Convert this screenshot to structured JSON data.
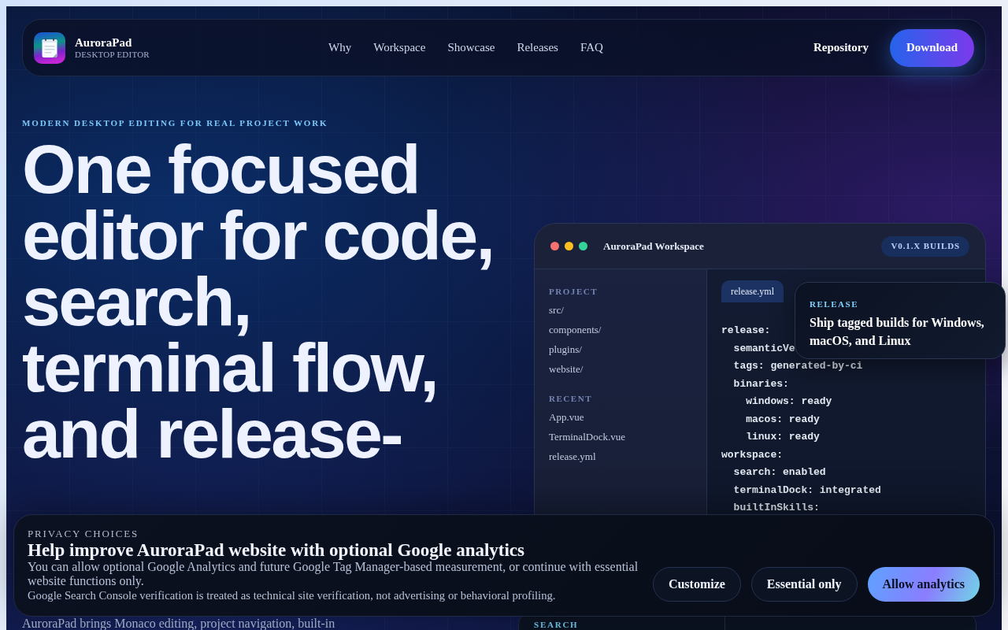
{
  "nav": {
    "brand": {
      "name": "AuroraPad",
      "tagline": "DESKTOP EDITOR"
    },
    "links": [
      {
        "label": "Why"
      },
      {
        "label": "Workspace"
      },
      {
        "label": "Showcase"
      },
      {
        "label": "Releases"
      },
      {
        "label": "FAQ"
      }
    ],
    "repository": "Repository",
    "download": "Download"
  },
  "hero": {
    "eyebrow": "MODERN DESKTOP EDITING FOR REAL PROJECT WORK",
    "headline": "One focused editor for code, search, terminal flow, and release-",
    "intro": "AuroraPad brings Monaco editing, project navigation, built-in"
  },
  "workspace": {
    "title": "AuroraPad Workspace",
    "badge": "V0.1.X BUILDS",
    "sidebar": [
      {
        "heading": "PROJECT",
        "items": [
          "src/",
          "components/",
          "plugins/",
          "website/"
        ]
      },
      {
        "heading": "RECENT",
        "items": [
          "App.vue",
          "TerminalDock.vue",
          "release.yml"
        ]
      }
    ],
    "tabs": [
      {
        "label": "release.yml",
        "selected": true
      }
    ],
    "code": [
      {
        "text": "release:",
        "children": [
          {
            "text": "semanticVe"
          },
          {
            "text": "tags: generated-by-ci"
          },
          {
            "text": "binaries:",
            "children": [
              {
                "text": "windows: ready"
              },
              {
                "text": "macos: ready"
              },
              {
                "text": "linux: ready"
              }
            ]
          }
        ]
      },
      {
        "text": "workspace:",
        "children": [
          {
            "text": "search: enabled"
          },
          {
            "text": "terminalDock: integrated"
          },
          {
            "text": "builtInSkills:"
          }
        ]
      }
    ]
  },
  "release_card": {
    "label": "RELEASE",
    "text": "Ship tagged builds for Windows, macOS, and Linux"
  },
  "search_card": {
    "label": "SEARCH"
  },
  "privacy_banner": {
    "eyebrow": "PRIVACY CHOICES",
    "title": "Help improve AuroraPad website with optional Google analytics",
    "description": "You can allow optional Google Analytics and future Google Tag Manager-based measurement, or continue with essential website functions only.",
    "note": "Google Search Console verification is treated as technical site verification, not advertising or behavioral profiling.",
    "buttons": [
      {
        "label": "Customize",
        "kind": "outline"
      },
      {
        "label": "Essential only",
        "kind": "outline"
      },
      {
        "label": "Allow analytics",
        "kind": "primary"
      }
    ]
  }
}
